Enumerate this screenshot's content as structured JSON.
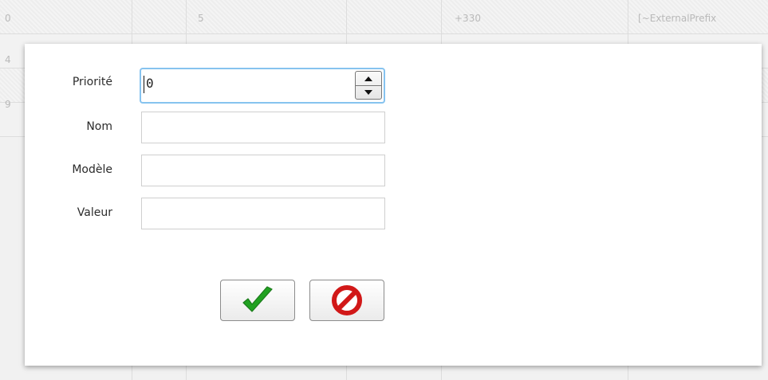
{
  "background_table": {
    "row1": {
      "col_a": "0",
      "col_b": "5",
      "col_c": "+330",
      "col_d": "[~ExternalPrefix"
    },
    "row2_prefix": "4",
    "row3_prefix": "9"
  },
  "form": {
    "fields": [
      {
        "label": "Priorité",
        "value": "0",
        "kind": "spinner"
      },
      {
        "label": "Nom",
        "value": "",
        "placeholder": ""
      },
      {
        "label": "Modèle",
        "value": "",
        "placeholder": ""
      },
      {
        "label": "Valeur",
        "value": "",
        "placeholder": ""
      }
    ],
    "actions": {
      "confirm_icon": "check-icon",
      "cancel_icon": "no-entry-icon"
    }
  },
  "colors": {
    "focus_border": "#86c3ef",
    "confirm_check": "#21a121",
    "cancel_red": "#d11818"
  }
}
